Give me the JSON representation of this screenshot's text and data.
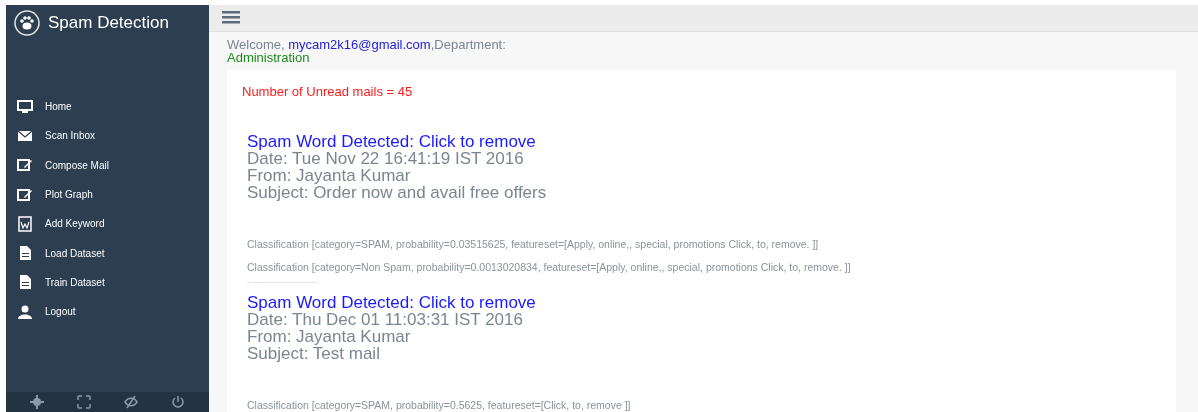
{
  "sidebar": {
    "title": "Spam Detection",
    "items": [
      {
        "label": "Home"
      },
      {
        "label": "Scan Inbox"
      },
      {
        "label": "Compose Mail"
      },
      {
        "label": "Plot Graph"
      },
      {
        "label": "Add Keyword"
      },
      {
        "label": "Load Dataset"
      },
      {
        "label": "Train Dataset"
      },
      {
        "label": "Logout"
      }
    ]
  },
  "welcome": {
    "prefix": "Welcome, ",
    "email": "mycam2k16@gmail.com",
    "suffix": ",Department:",
    "department": "Administration"
  },
  "unread": "Number of Unread mails = 45",
  "mails": [
    {
      "title": "Spam Word Detected: Click to remove",
      "date": "Date: Tue Nov 22 16:41:19 IST 2016",
      "from": "From: Jayanta Kumar",
      "subject": "Subject: Order now and avail free offers",
      "classifications": [
        "Classification [category=SPAM, probability=0.03515625, featureset=[Apply, online,, special, promotions Click, to, remove. ]]",
        "Classification [category=Non Spam, probability=0.0013020834, featureset=[Apply, online,, special, promotions Click, to, remove. ]]"
      ],
      "separator": "------------------------------"
    },
    {
      "title": "Spam Word Detected: Click to remove",
      "date": "Date: Thu Dec 01 11:03:31 IST 2016",
      "from": "From: Jayanta Kumar",
      "subject": "Subject: Test mail",
      "classifications": [
        "Classification [category=SPAM, probability=0.5625, featureset=[Click, to, remove ]]"
      ]
    }
  ]
}
